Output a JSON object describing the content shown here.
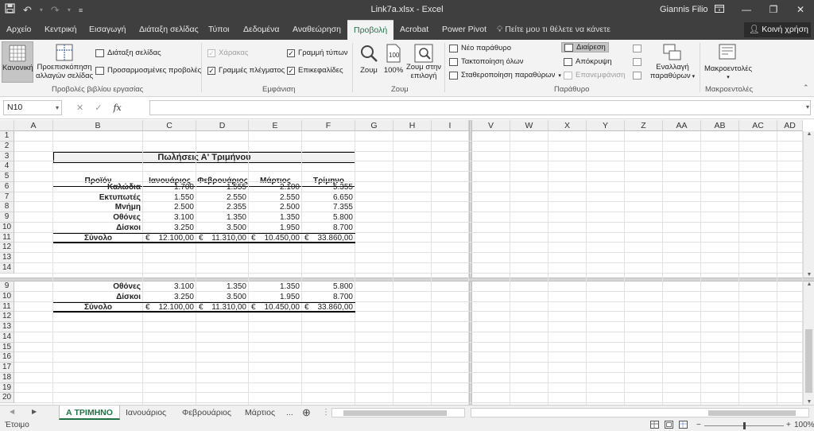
{
  "titlebar": {
    "document_title": "Link7a.xlsx - Excel",
    "user": "Giannis Filio",
    "icons": [
      "save-icon",
      "undo-icon",
      "redo-icon",
      "customize-qat-icon",
      "ribbon-display-icon",
      "minimize-icon",
      "restore-icon",
      "close-icon"
    ]
  },
  "tabs": {
    "items": [
      "Αρχείο",
      "Κεντρική",
      "Εισαγωγή",
      "Διάταξη σελίδας",
      "Τύποι",
      "Δεδομένα",
      "Αναθεώρηση",
      "Προβολή",
      "Acrobat",
      "Power Pivot"
    ],
    "active": "Προβολή",
    "tell_me": "Πείτε μου τι θέλετε να κάνετε",
    "share": "Κοινή χρήση"
  },
  "ribbon": {
    "workbook_views": {
      "label": "Προβολές βιβλίου εργασίας",
      "normal": "Κανονική",
      "page_break_preview_1": "Προεπισκόπηση",
      "page_break_preview_2": "αλλαγών σελίδας",
      "page_layout": "Διάταξη σελίδας",
      "custom_views": "Προσαρμοσμένες προβολές"
    },
    "show": {
      "label": "Εμφάνιση",
      "ruler": "Χάρακας",
      "gridlines": "Γραμμές πλέγματος",
      "formula_bar": "Γραμμή τύπων",
      "headings": "Επικεφαλίδες"
    },
    "zoom": {
      "label": "Ζουμ",
      "zoom": "Ζουμ",
      "hundred": "100%",
      "zoom_selection_1": "Ζουμ στην",
      "zoom_selection_2": "επιλογή"
    },
    "window": {
      "label": "Παράθυρο",
      "new_window": "Νέο παράθυρο",
      "arrange_all": "Τακτοποίηση όλων",
      "freeze_panes": "Σταθεροποίηση παραθύρων",
      "split": "Διαίρεση",
      "hide": "Απόκρυψη",
      "unhide": "Επανεμφάνιση",
      "switch_windows_1": "Εναλλαγή",
      "switch_windows_2": "παραθύρων"
    },
    "macros": {
      "label": "Μακροεντολές",
      "macros": "Μακροεντολές"
    }
  },
  "formula_bar": {
    "name_box": "N10",
    "fx": "fx",
    "value": ""
  },
  "columns_left": [
    "A",
    "B",
    "C",
    "D",
    "E",
    "F",
    "G",
    "H",
    "I"
  ],
  "columns_right": [
    "V",
    "W",
    "X",
    "Y",
    "Z",
    "AA",
    "AB",
    "AC",
    "AD"
  ],
  "rows_top": [
    "1",
    "2",
    "3",
    "4",
    "5",
    "6",
    "7",
    "8",
    "9",
    "10",
    "11",
    "12",
    "13",
    "14"
  ],
  "rows_bottom": [
    "9",
    "10",
    "11",
    "12",
    "13",
    "14",
    "15",
    "16",
    "17",
    "18",
    "19",
    "20"
  ],
  "table": {
    "title": "Πωλήσεις Α' Τριμήνου",
    "headers": [
      "Προϊόν",
      "Ιανουάριος",
      "Φεβρουάριος",
      "Μάρτιος",
      "Τρίμηνο"
    ],
    "rows": [
      [
        "Καλώδια",
        "1.700",
        "1.555",
        "2.100",
        "5.355"
      ],
      [
        "Εκτυπωτές",
        "1.550",
        "2.550",
        "2.550",
        "6.650"
      ],
      [
        "Μνήμη",
        "2.500",
        "2.355",
        "2.500",
        "7.355"
      ],
      [
        "Οθόνες",
        "3.100",
        "1.350",
        "1.350",
        "5.800"
      ],
      [
        "Δίσκοι",
        "3.250",
        "3.500",
        "1.950",
        "8.700"
      ]
    ],
    "total": {
      "label": "Σύνολο",
      "currency": "€",
      "values": [
        "12.100,00",
        "11.310,00",
        "10.450,00",
        "33.860,00"
      ]
    }
  },
  "sheet_tabs": {
    "items": [
      "Α ΤΡΙΜΗΝΟ",
      "Ιανουάριος",
      "Φεβρουάριος",
      "Μάρτιος"
    ],
    "active": "Α ΤΡΙΜΗΝΟ",
    "more": "...",
    "add": "⊕"
  },
  "statusbar": {
    "status": "Έτοιμο",
    "zoom_minus": "−",
    "zoom_plus": "+",
    "zoom_level": "100%",
    "zoom_fraction": 0.5
  }
}
